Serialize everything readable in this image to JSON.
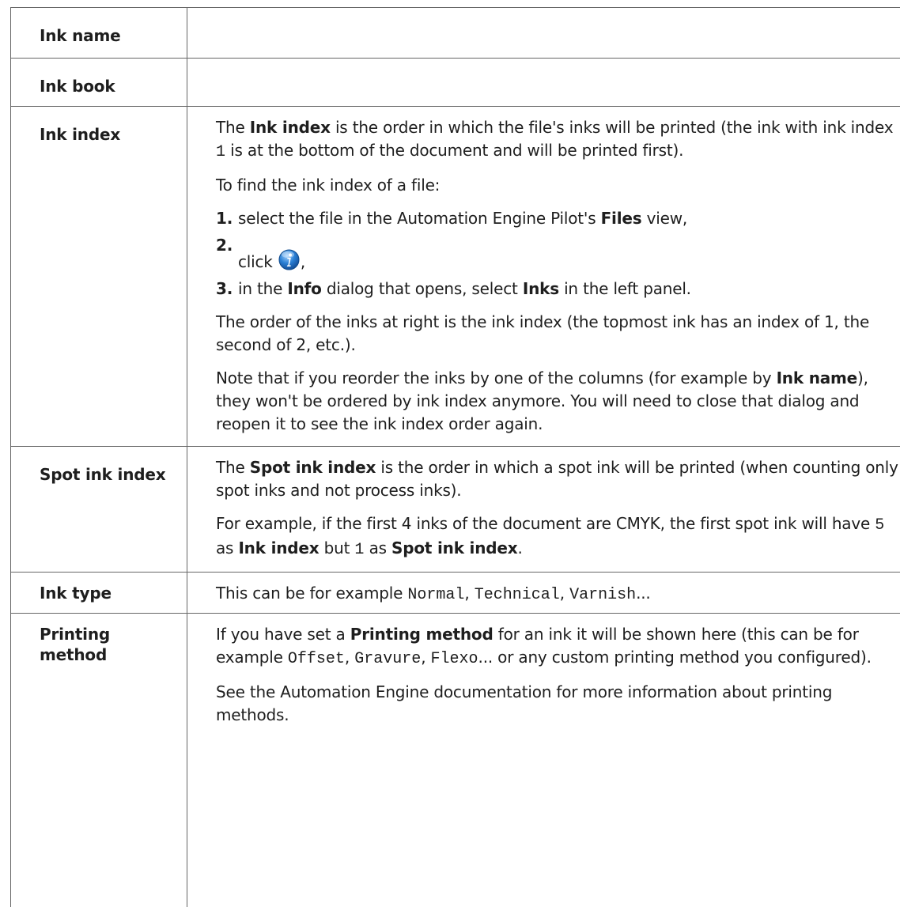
{
  "rows": {
    "ink_name": {
      "label": "Ink name"
    },
    "ink_book": {
      "label": "Ink book"
    },
    "ink_index": {
      "label": "Ink index",
      "p1_bold": "Ink index",
      "p1_text": " is the order in which the file's inks will be printed (the ink with ink index ",
      "p1_code": "1",
      "p1_end": " is at the bottom of the document and will be printed first).",
      "p1_start": "The ",
      "p2": "To find the ink index of a file:",
      "steps": [
        {
          "num": "1.",
          "pre": "select the file in the Automation Engine Pilot's ",
          "bold": "Files",
          "post": " view,"
        },
        {
          "num": "2.",
          "pre": "click ",
          "icon": "info-icon",
          "post": ","
        },
        {
          "num": "3.",
          "pre": "in the ",
          "bold": "Info",
          "mid": " dialog that opens, select ",
          "bold2": "Inks",
          "post": " in the left panel."
        }
      ],
      "p3": "The order of the inks at right is the ink index (the topmost ink has an index of 1, the second of 2, etc.).",
      "p4_pre": "Note that if you reorder the inks by one of the columns (for example by ",
      "p4_bold": "Ink name",
      "p4_post": "), they won't be ordered by ink index anymore. You will need to close that dialog and reopen it to see the ink index order again."
    },
    "spot_ink_index": {
      "label": "Spot ink index",
      "p1_pre": "The ",
      "p1_bold": "Spot ink index",
      "p1_post": " is the order in which a spot ink will be printed (when counting only spot inks and not process inks).",
      "p2_pre": "For example, if the first 4 inks of the document are CMYK, the first spot ink will have ",
      "p2_code1": "5",
      "p2_mid1": " as ",
      "p2_bold1": "Ink index",
      "p2_mid2": " but ",
      "p2_code2": "1",
      "p2_mid3": " as ",
      "p2_bold2": "Spot ink index",
      "p2_end": "."
    },
    "ink_type": {
      "label": "Ink type",
      "pre": "This can be for example ",
      "code1": "Normal",
      "sep1": ", ",
      "code2": "Technical",
      "sep2": ", ",
      "code3": "Varnish",
      "end": "..."
    },
    "printing_method": {
      "label": "Printing method",
      "p1_pre": "If you have set a ",
      "p1_bold": "Printing method",
      "p1_mid": " for an ink it will be shown here (this can be for example ",
      "p1_code1": "Offset",
      "p1_sep1": ", ",
      "p1_code2": "Gravure",
      "p1_sep2": ", ",
      "p1_code3": "Flexo",
      "p1_end": "... or any custom printing method you configured).",
      "p2": "See the Automation Engine documentation for more information about printing methods."
    }
  },
  "colors": {
    "border": "#666666",
    "text": "#1e1e1e",
    "icon_blue": "#2a7fd4"
  }
}
